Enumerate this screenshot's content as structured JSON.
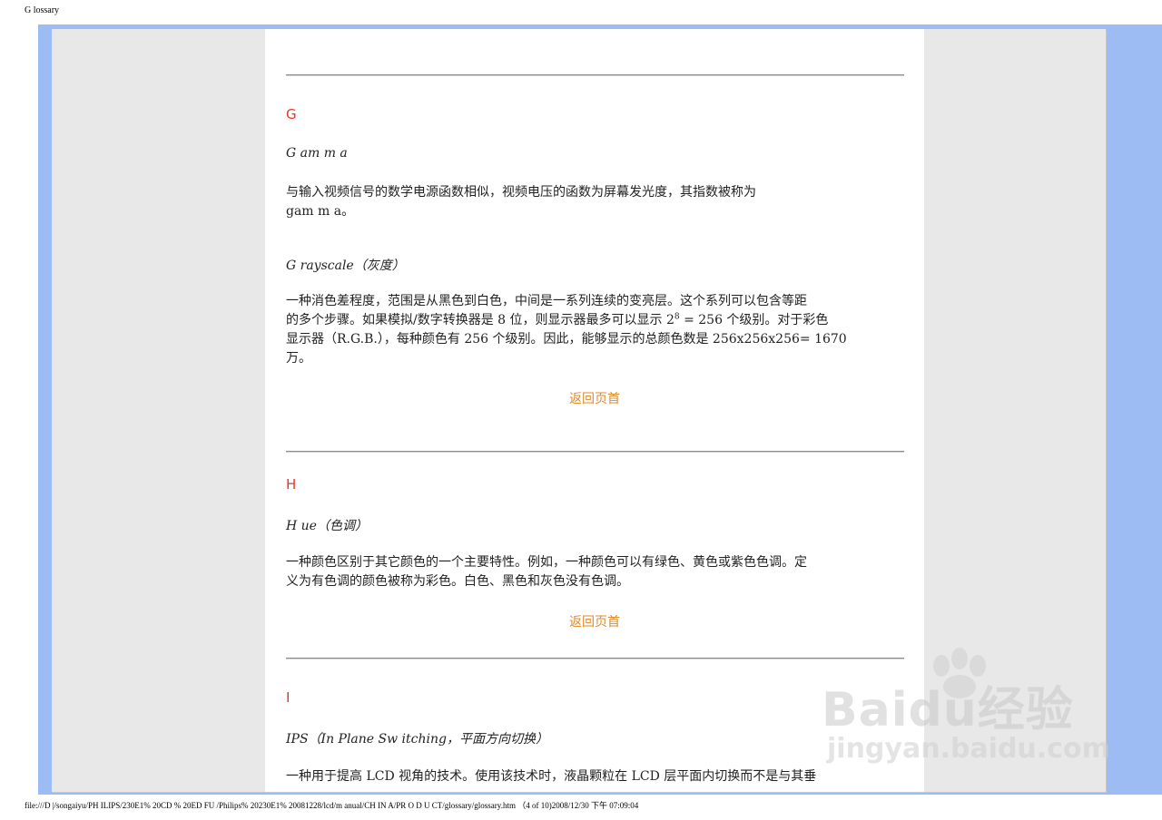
{
  "print_header": "G lossary",
  "print_footer": "file:///D |/songaiyu/PH ILIPS/230E1% 20CD % 20ED FU /Philips% 20230E1% 20081228/lcd/m anual/CH IN A/PR O D U CT/glossary/glossary.htm （4 of 10)2008/12/30 下午 07:09:04",
  "sections": {
    "g": {
      "letter": "G",
      "gamma_term": "G am m a",
      "gamma_desc_1": "与输入视频信号的数学电源函数相似，视频电压的函数为屏幕发光度，其指数被称为",
      "gamma_desc_2": "gam m a。",
      "grayscale_term": "G rayscale（灰度）",
      "grayscale_desc_1": "一种消色差程度，范围是从黑色到白色，中间是一系列连续的变亮层。这个系列可以包含等距",
      "grayscale_desc_2a": "的多个步骤。如果模拟/数字转换器是 8 位，则显示器最多可以显示 2",
      "grayscale_desc_2sup": "8",
      "grayscale_desc_2b": " = 256 个级别。对于彩色",
      "grayscale_desc_3": "显示器（R.G.B.），每种颜色有 256 个级别。因此，能够显示的总颜色数是 256x256x256= 1670",
      "grayscale_desc_4": "万。",
      "back_to_top": "返回页首"
    },
    "h": {
      "letter": "H",
      "hue_term": "H ue（色调）",
      "hue_desc_1": "一种颜色区别于其它颜色的一个主要特性。例如，一种颜色可以有绿色、黄色或紫色色调。定",
      "hue_desc_2": "义为有色调的颜色被称为彩色。白色、黑色和灰色没有色调。",
      "back_to_top": "返回页首"
    },
    "i": {
      "letter": "I",
      "ips_term": "IPS（In Plane Sw itching，平面方向切换）",
      "ips_desc_1": "一种用于提高 LCD 视角的技术。使用该技术时，液晶颗粒在 LCD 层平面内切换而不是与其垂"
    }
  },
  "watermark": {
    "text": "Baidu经验",
    "sub": "jingyan.baidu.com",
    "icon": "paw-icon"
  },
  "colors": {
    "frame": "#9dbcf4",
    "panel": "#e8e8e8",
    "letter_heading": "#e03a2a",
    "back_link": "#e08a2a"
  }
}
